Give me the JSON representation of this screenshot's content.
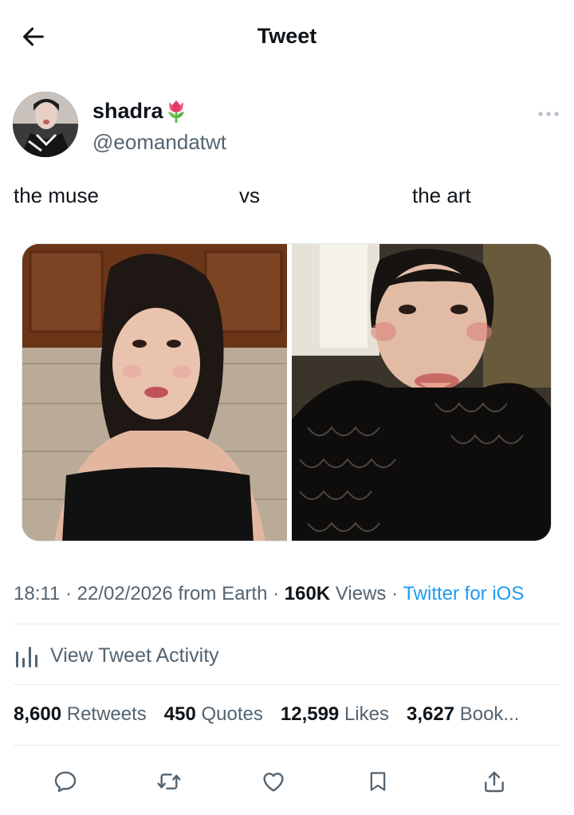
{
  "header": {
    "back_icon": "arrow-left-icon",
    "title": "Tweet"
  },
  "author": {
    "display_name": "shadra",
    "emoji_icon": "tulip-icon",
    "handle": "@eomandatwt",
    "more_icon": "more-horizontal-icon"
  },
  "tweet": {
    "text_parts": [
      "the muse",
      "vs",
      "the art"
    ]
  },
  "media": {
    "images": [
      {
        "name": "photo-left"
      },
      {
        "name": "photo-right"
      }
    ]
  },
  "meta": {
    "time": "18:11",
    "sep1": " · ",
    "date": "22/02/2026 from Earth",
    "sep2": " · ",
    "views_count": "160K",
    "views_label": " Views",
    "sep3": " · ",
    "source": "Twitter for iOS"
  },
  "activity": {
    "icon": "bar-chart-icon",
    "label": "View Tweet Activity"
  },
  "stats": [
    {
      "count": "8,600",
      "label": " Retweets"
    },
    {
      "count": "450",
      "label": " Quotes"
    },
    {
      "count": "12,599",
      "label": " Likes"
    },
    {
      "count": "3,627",
      "label": " Book..."
    }
  ],
  "actions": [
    "reply-icon",
    "retweet-icon",
    "like-icon",
    "bookmark-icon",
    "share-icon"
  ],
  "colors": {
    "text": "#0f1419",
    "secondary": "#536471",
    "link": "#1d9bf0",
    "divider": "#e6ecf0"
  }
}
